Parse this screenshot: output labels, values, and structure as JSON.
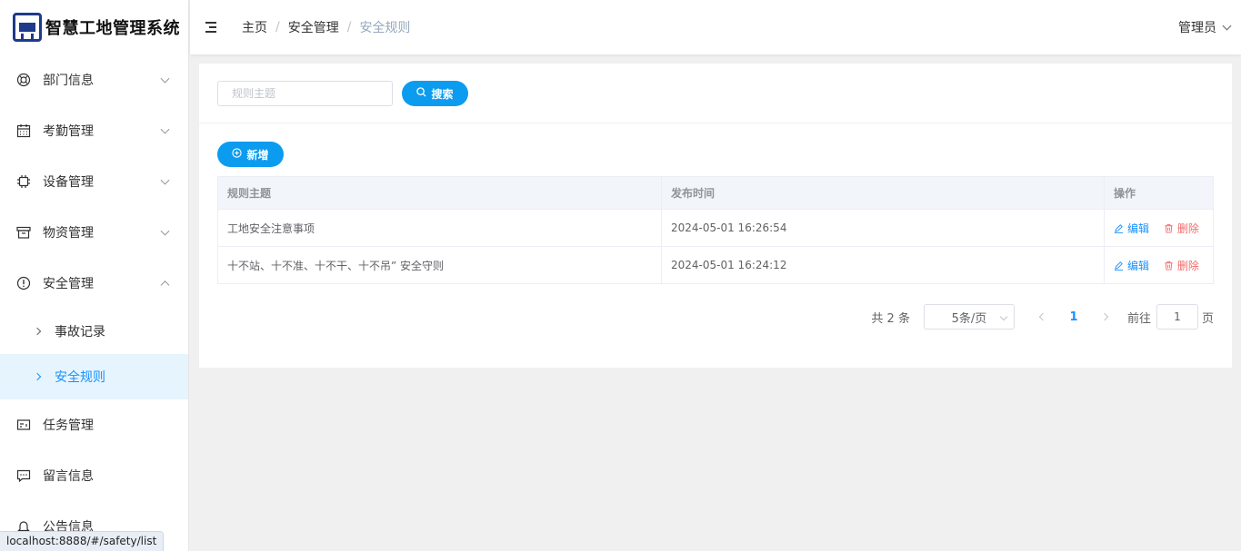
{
  "app": {
    "title": "智慧工地管理系统"
  },
  "sidebar": {
    "items": [
      {
        "label": "部门信息",
        "icon": "lifebuoy-icon"
      },
      {
        "label": "考勤管理",
        "icon": "calendar-icon"
      },
      {
        "label": "设备管理",
        "icon": "chip-icon"
      },
      {
        "label": "物资管理",
        "icon": "box-icon"
      },
      {
        "label": "安全管理",
        "icon": "warning-circle-icon"
      },
      {
        "label": "任务管理",
        "icon": "postcard-icon"
      },
      {
        "label": "留言信息",
        "icon": "chat-icon"
      },
      {
        "label": "公告信息",
        "icon": "bell-icon"
      }
    ],
    "sub_items": [
      {
        "label": "事故记录"
      },
      {
        "label": "安全规则"
      }
    ]
  },
  "header": {
    "breadcrumb": [
      "主页",
      "安全管理",
      "安全规则"
    ],
    "user": "管理员"
  },
  "search": {
    "placeholder": "规则主题",
    "button": "搜索"
  },
  "toolbar": {
    "add": "新增"
  },
  "table": {
    "columns": [
      "规则主题",
      "发布时间",
      "操作"
    ],
    "rows": [
      {
        "title": "工地安全注意事项",
        "time": "2024-05-01 16:26:54"
      },
      {
        "title": "十不站、十不准、十不干、十不吊” 安全守则",
        "time": "2024-05-01 16:24:12"
      }
    ],
    "edit_label": "编辑",
    "delete_label": "删除"
  },
  "pagination": {
    "total": "共 2 条",
    "page_size": "5条/页",
    "current": "1",
    "goto_prefix": "前往",
    "goto_value": "1",
    "goto_suffix": "页"
  },
  "status_url": "localhost:8888/#/safety/list",
  "colors": {
    "primary": "#0b9cf0",
    "link": "#1890ff",
    "danger": "#f56c6c"
  }
}
